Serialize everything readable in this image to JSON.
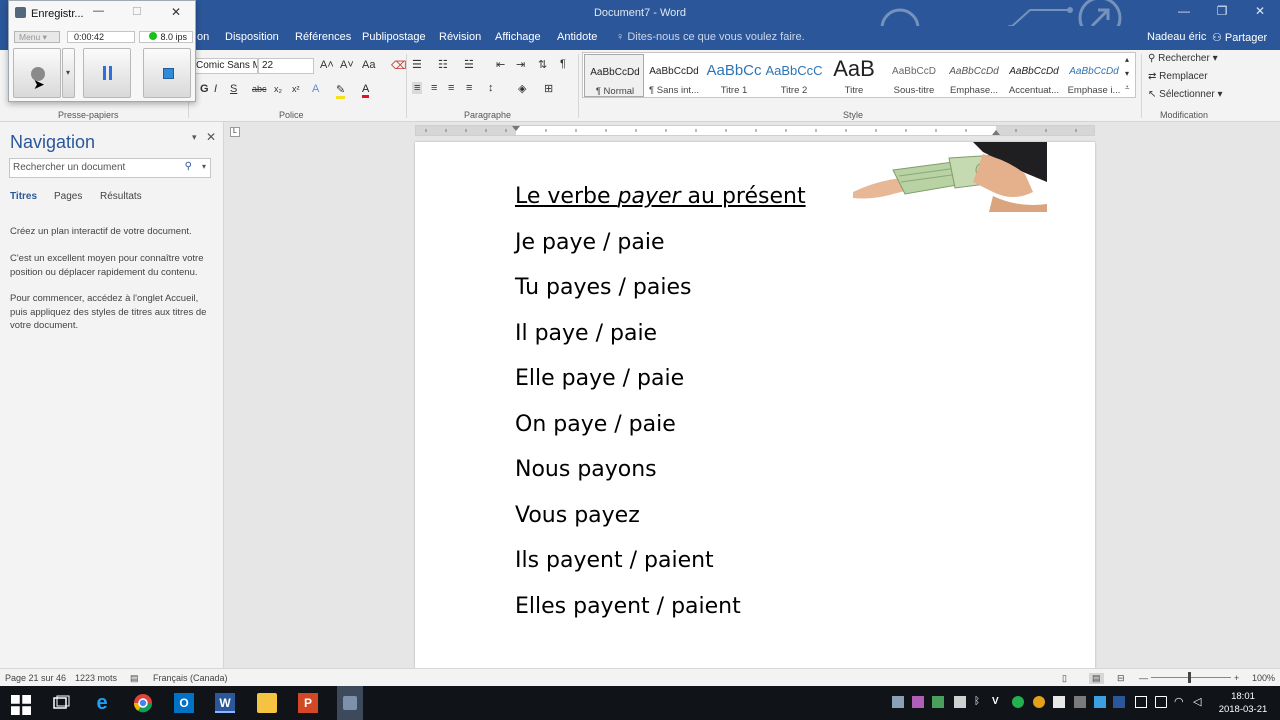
{
  "window": {
    "title": "Document7 - Word",
    "user": "Nadeau éric",
    "share_label": "Partager"
  },
  "tabs": [
    "Disposition",
    "Références",
    "Publipostage",
    "Révision",
    "Affichage",
    "Antidote"
  ],
  "tab_partial": "on",
  "tell_me": "Dites-nous ce que vous voulez faire.",
  "ribbon": {
    "font_name": "Comic Sans M",
    "font_size": "22",
    "groups": {
      "clipboard": "Presse-papiers",
      "font": "Police",
      "paragraph": "Paragraphe",
      "style": "Style",
      "editing": "Modification"
    },
    "styles": [
      {
        "preview": "AaBbCcDd",
        "name": "¶ Normal"
      },
      {
        "preview": "AaBbCcDd",
        "name": "¶ Sans int..."
      },
      {
        "preview": "AaBbCc",
        "name": "Titre 1"
      },
      {
        "preview": "AaBbCcC",
        "name": "Titre 2"
      },
      {
        "preview": "AaB",
        "name": "Titre"
      },
      {
        "preview": "AaBbCcD",
        "name": "Sous-titre"
      },
      {
        "preview": "AaBbCcDd",
        "name": "Emphase..."
      },
      {
        "preview": "AaBbCcDd",
        "name": "Accentuat..."
      },
      {
        "preview": "AaBbCcDd",
        "name": "Emphase i..."
      }
    ],
    "editing": {
      "find": "Rechercher",
      "replace": "Remplacer",
      "select": "Sélectionner"
    }
  },
  "recorder": {
    "title": "Enregistr...",
    "menu": "Menu",
    "time": "0:00:42",
    "fps": "8.0 ips"
  },
  "nav": {
    "title": "Navigation",
    "search_placeholder": "Rechercher un document",
    "tabs": [
      "Titres",
      "Pages",
      "Résultats"
    ],
    "paragraphs": [
      "Créez un plan interactif de votre document.",
      "C'est un excellent moyen pour connaître votre position ou déplacer rapidement du contenu.",
      "Pour commencer, accédez à l'onglet Accueil, puis appliquez des styles de titres aux titres de votre document."
    ]
  },
  "document": {
    "title_before": "Le verbe ",
    "title_italic": "payer",
    "title_after": " au présent",
    "lines": [
      "Je paye / paie",
      "Tu payes / paies",
      "Il paye / paie",
      "Elle paye / paie",
      "On paye / paie",
      "Nous payons",
      "Vous payez",
      "Ils payent / paient",
      "Elles payent / paient"
    ]
  },
  "status": {
    "page": "Page 21 sur 46",
    "words": "1223 mots",
    "language": "Français (Canada)",
    "zoom": "100%"
  },
  "clock": {
    "time": "18:01",
    "date": "2018-03-21"
  },
  "colors": {
    "accent": "#2b579a",
    "taskbar": "#101418"
  }
}
